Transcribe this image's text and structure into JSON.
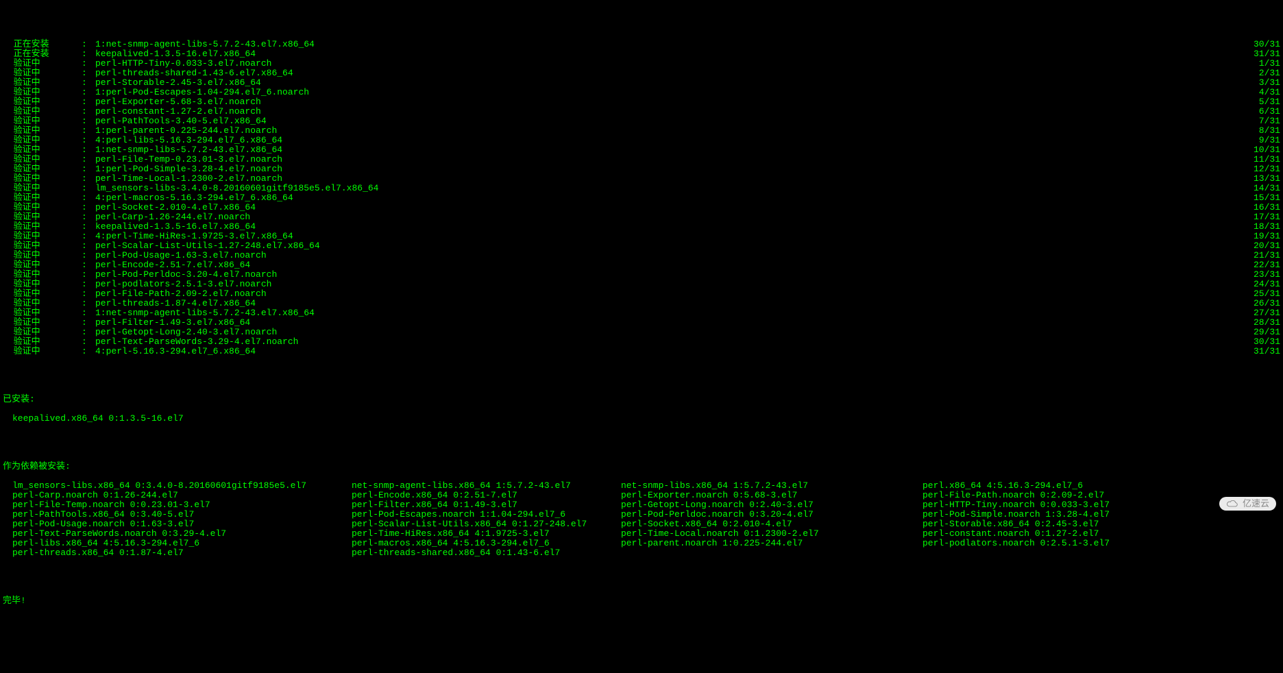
{
  "lines": [
    {
      "status": "正在安装",
      "pkg": "1:net-snmp-agent-libs-5.7.2-43.el7.x86_64",
      "counter": "30/31"
    },
    {
      "status": "正在安装",
      "pkg": "keepalived-1.3.5-16.el7.x86_64",
      "counter": "31/31"
    },
    {
      "status": "验证中",
      "pkg": "perl-HTTP-Tiny-0.033-3.el7.noarch",
      "counter": "1/31"
    },
    {
      "status": "验证中",
      "pkg": "perl-threads-shared-1.43-6.el7.x86_64",
      "counter": "2/31"
    },
    {
      "status": "验证中",
      "pkg": "perl-Storable-2.45-3.el7.x86_64",
      "counter": "3/31"
    },
    {
      "status": "验证中",
      "pkg": "1:perl-Pod-Escapes-1.04-294.el7_6.noarch",
      "counter": "4/31"
    },
    {
      "status": "验证中",
      "pkg": "perl-Exporter-5.68-3.el7.noarch",
      "counter": "5/31"
    },
    {
      "status": "验证中",
      "pkg": "perl-constant-1.27-2.el7.noarch",
      "counter": "6/31"
    },
    {
      "status": "验证中",
      "pkg": "perl-PathTools-3.40-5.el7.x86_64",
      "counter": "7/31"
    },
    {
      "status": "验证中",
      "pkg": "1:perl-parent-0.225-244.el7.noarch",
      "counter": "8/31"
    },
    {
      "status": "验证中",
      "pkg": "4:perl-libs-5.16.3-294.el7_6.x86_64",
      "counter": "9/31"
    },
    {
      "status": "验证中",
      "pkg": "1:net-snmp-libs-5.7.2-43.el7.x86_64",
      "counter": "10/31"
    },
    {
      "status": "验证中",
      "pkg": "perl-File-Temp-0.23.01-3.el7.noarch",
      "counter": "11/31"
    },
    {
      "status": "验证中",
      "pkg": "1:perl-Pod-Simple-3.28-4.el7.noarch",
      "counter": "12/31"
    },
    {
      "status": "验证中",
      "pkg": "perl-Time-Local-1.2300-2.el7.noarch",
      "counter": "13/31"
    },
    {
      "status": "验证中",
      "pkg": "lm_sensors-libs-3.4.0-8.20160601gitf9185e5.el7.x86_64",
      "counter": "14/31"
    },
    {
      "status": "验证中",
      "pkg": "4:perl-macros-5.16.3-294.el7_6.x86_64",
      "counter": "15/31"
    },
    {
      "status": "验证中",
      "pkg": "perl-Socket-2.010-4.el7.x86_64",
      "counter": "16/31"
    },
    {
      "status": "验证中",
      "pkg": "perl-Carp-1.26-244.el7.noarch",
      "counter": "17/31"
    },
    {
      "status": "验证中",
      "pkg": "keepalived-1.3.5-16.el7.x86_64",
      "counter": "18/31"
    },
    {
      "status": "验证中",
      "pkg": "4:perl-Time-HiRes-1.9725-3.el7.x86_64",
      "counter": "19/31"
    },
    {
      "status": "验证中",
      "pkg": "perl-Scalar-List-Utils-1.27-248.el7.x86_64",
      "counter": "20/31"
    },
    {
      "status": "验证中",
      "pkg": "perl-Pod-Usage-1.63-3.el7.noarch",
      "counter": "21/31"
    },
    {
      "status": "验证中",
      "pkg": "perl-Encode-2.51-7.el7.x86_64",
      "counter": "22/31"
    },
    {
      "status": "验证中",
      "pkg": "perl-Pod-Perldoc-3.20-4.el7.noarch",
      "counter": "23/31"
    },
    {
      "status": "验证中",
      "pkg": "perl-podlators-2.5.1-3.el7.noarch",
      "counter": "24/31"
    },
    {
      "status": "验证中",
      "pkg": "perl-File-Path-2.09-2.el7.noarch",
      "counter": "25/31"
    },
    {
      "status": "验证中",
      "pkg": "perl-threads-1.87-4.el7.x86_64",
      "counter": "26/31"
    },
    {
      "status": "验证中",
      "pkg": "1:net-snmp-agent-libs-5.7.2-43.el7.x86_64",
      "counter": "27/31"
    },
    {
      "status": "验证中",
      "pkg": "perl-Filter-1.49-3.el7.x86_64",
      "counter": "28/31"
    },
    {
      "status": "验证中",
      "pkg": "perl-Getopt-Long-2.40-3.el7.noarch",
      "counter": "29/31"
    },
    {
      "status": "验证中",
      "pkg": "perl-Text-ParseWords-3.29-4.el7.noarch",
      "counter": "30/31"
    },
    {
      "status": "验证中",
      "pkg": "4:perl-5.16.3-294.el7_6.x86_64",
      "counter": "31/31"
    }
  ],
  "installed_header": "已安装:",
  "installed_item": "keepalived.x86_64 0:1.3.5-16.el7",
  "deps_header": "作为依赖被安装:",
  "deps": {
    "col0": [
      "lm_sensors-libs.x86_64 0:3.4.0-8.20160601gitf9185e5.el7",
      "perl-Carp.noarch 0:1.26-244.el7",
      "perl-File-Temp.noarch 0:0.23.01-3.el7",
      "perl-PathTools.x86_64 0:3.40-5.el7",
      "perl-Pod-Usage.noarch 0:1.63-3.el7",
      "perl-Text-ParseWords.noarch 0:3.29-4.el7",
      "perl-libs.x86_64 4:5.16.3-294.el7_6",
      "perl-threads.x86_64 0:1.87-4.el7"
    ],
    "col1": [
      "net-snmp-agent-libs.x86_64 1:5.7.2-43.el7",
      "perl-Encode.x86_64 0:2.51-7.el7",
      "perl-Filter.x86_64 0:1.49-3.el7",
      "perl-Pod-Escapes.noarch 1:1.04-294.el7_6",
      "perl-Scalar-List-Utils.x86_64 0:1.27-248.el7",
      "perl-Time-HiRes.x86_64 4:1.9725-3.el7",
      "perl-macros.x86_64 4:5.16.3-294.el7_6",
      "perl-threads-shared.x86_64 0:1.43-6.el7"
    ],
    "col2": [
      "net-snmp-libs.x86_64 1:5.7.2-43.el7",
      "perl-Exporter.noarch 0:5.68-3.el7",
      "perl-Getopt-Long.noarch 0:2.40-3.el7",
      "perl-Pod-Perldoc.noarch 0:3.20-4.el7",
      "perl-Socket.x86_64 0:2.010-4.el7",
      "perl-Time-Local.noarch 0:1.2300-2.el7",
      "perl-parent.noarch 1:0.225-244.el7"
    ],
    "col3": [
      "perl.x86_64 4:5.16.3-294.el7_6",
      "perl-File-Path.noarch 0:2.09-2.el7",
      "perl-HTTP-Tiny.noarch 0:0.033-3.el7",
      "perl-Pod-Simple.noarch 1:3.28-4.el7",
      "perl-Storable.x86_64 0:2.45-3.el7",
      "perl-constant.noarch 0:1.27-2.el7",
      "perl-podlators.noarch 0:2.5.1-3.el7"
    ]
  },
  "complete": "完毕!",
  "watermark": "亿速云"
}
